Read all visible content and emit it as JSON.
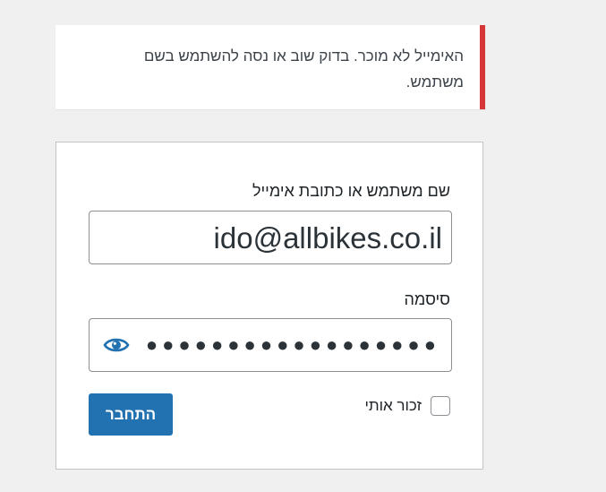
{
  "notice": {
    "type": "error",
    "accent_color": "#d63638",
    "message": "האימייל לא מוכר. בדוק שוב או נסה להשתמש בשם משתמש."
  },
  "login_form": {
    "username_label": "שם משתמש או כתובת אימייל",
    "username_value": "ido@allbikes.co.il",
    "password_label": "סיסמה",
    "password_masked": "●●●●●●●●●●●●●●●●●●",
    "show_password_icon": "eye-icon",
    "remember_me_label": "זכור אותי",
    "remember_me_checked": false,
    "submit_label": "התחבר",
    "accent_color": "#2271b1"
  }
}
